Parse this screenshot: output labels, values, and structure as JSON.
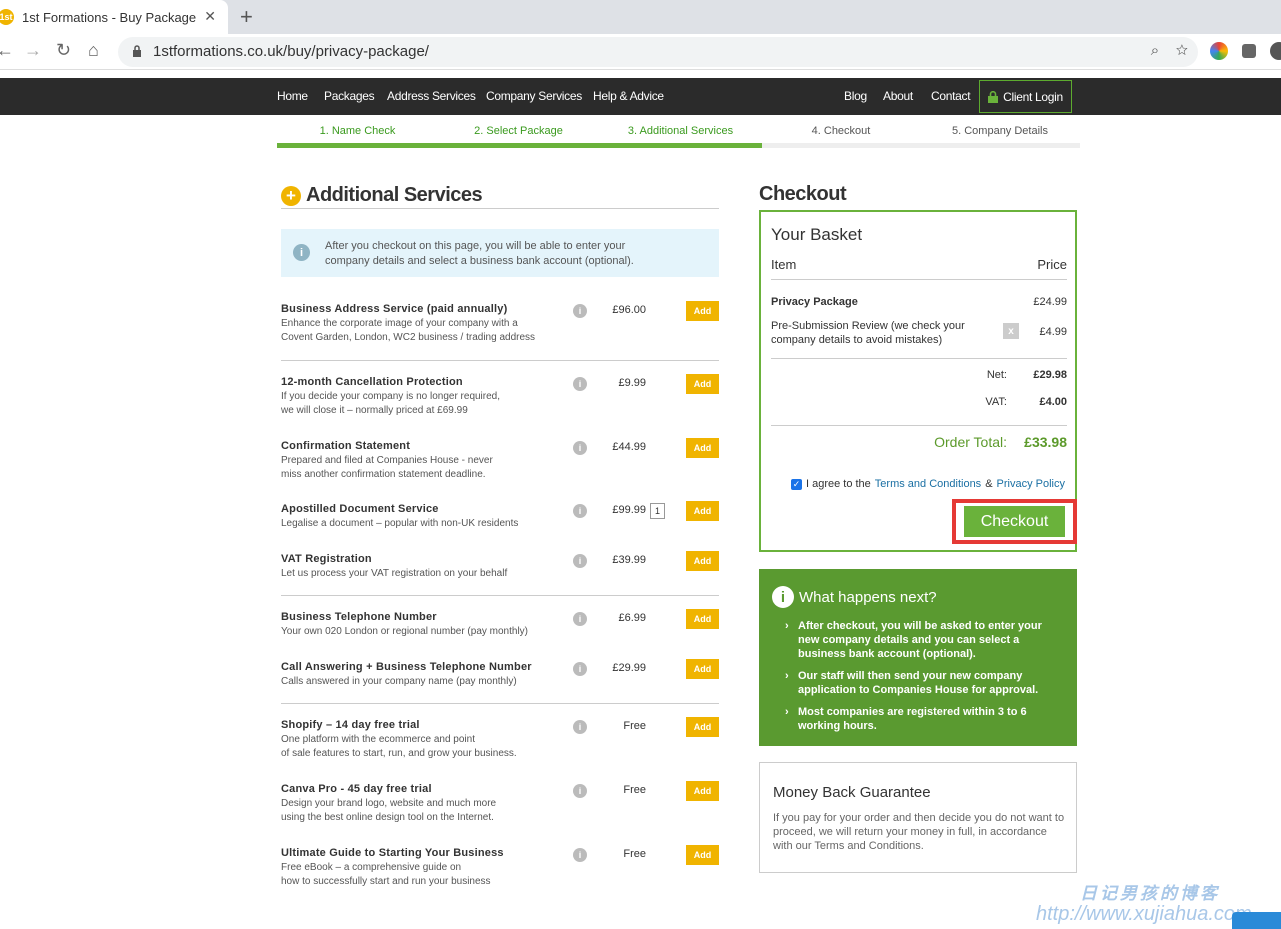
{
  "browser": {
    "tab_title": "1st Formations - Buy Package",
    "url": "1stformations.co.uk/buy/privacy-package/"
  },
  "nav": {
    "left": [
      "Home",
      "Packages",
      "Address Services",
      "Company Services",
      "Help & Advice"
    ],
    "right": [
      "Blog",
      "About",
      "Contact"
    ],
    "login": "Client Login"
  },
  "steps": [
    "1. Name Check",
    "2. Select Package",
    "3. Additional Services",
    "4. Checkout",
    "5. Company Details"
  ],
  "additional": {
    "title": "Additional Services",
    "info": "After you checkout on this page, you will be able to enter your company details and select a business bank account (optional).",
    "add_label": "Add",
    "services": [
      {
        "name": "Business Address Service (paid annually)",
        "desc1": "Enhance the corporate image of your company with a",
        "desc2": "Covent Garden, London, WC2 business / trading address",
        "price": "£96.00"
      },
      {
        "name": "12-month Cancellation Protection",
        "desc1": "If you decide your company is no longer required,",
        "desc2": "we will close it – normally priced at £69.99",
        "price": "£9.99"
      },
      {
        "name": "Confirmation Statement",
        "desc1": "Prepared and filed at Companies House - never",
        "desc2": "miss another confirmation statement deadline.",
        "price": "£44.99"
      },
      {
        "name": "Apostilled Document Service",
        "desc1": "Legalise a document – popular with non-UK residents",
        "desc2": "",
        "price": "£99.99",
        "qty": "1"
      },
      {
        "name": "VAT Registration",
        "desc1": "Let us process your VAT registration on your behalf",
        "desc2": "",
        "price": "£39.99"
      },
      {
        "name": "Business Telephone Number",
        "desc1": "Your own 020 London or regional number (pay monthly)",
        "desc2": "",
        "price": "£6.99"
      },
      {
        "name": "Call Answering + Business Telephone Number",
        "desc1": "Calls answered in your company name (pay monthly)",
        "desc2": "",
        "price": "£29.99"
      },
      {
        "name": "Shopify – 14 day free trial",
        "desc1": "One platform with the ecommerce and point",
        "desc2": "of sale features to start, run, and grow your business.",
        "price": "Free"
      },
      {
        "name": "Canva Pro - 45 day free trial",
        "desc1": "Design your brand logo, website and much more",
        "desc2": "using the best online design tool on the Internet.",
        "price": "Free"
      },
      {
        "name": "Ultimate Guide to Starting Your Business",
        "desc1": "Free eBook – a comprehensive guide on",
        "desc2": "how to successfully start and run your business",
        "price": "Free"
      }
    ]
  },
  "checkout": {
    "title": "Checkout",
    "basket_title": "Your Basket",
    "col_item": "Item",
    "col_price": "Price",
    "items": [
      {
        "name": "Privacy Package",
        "price": "£24.99"
      },
      {
        "name": "Pre-Submission Review (we check your company details to avoid mistakes)",
        "price": "£4.99",
        "remove": "x"
      }
    ],
    "net_label": "Net:",
    "net": "£29.98",
    "vat_label": "VAT:",
    "vat": "£4.00",
    "total_label": "Order Total:",
    "total": "£33.98",
    "agree_text": "I agree to the",
    "terms_link": "Terms and Conditions",
    "amp": "&",
    "privacy_link": "Privacy Policy",
    "button": "Checkout"
  },
  "next": {
    "title": "What happens next?",
    "items": [
      "After checkout, you will be asked to enter your new company details and you can select a business bank account (optional).",
      "Our staff will then send your new company application to Companies House for approval.",
      "Most companies are registered within 3 to 6 working hours."
    ]
  },
  "guarantee": {
    "title": "Money Back Guarantee",
    "text": "If you pay for your order and then decide you do not want to proceed, we will return your money in full, in accordance with our Terms and Conditions."
  },
  "watermark": {
    "line1": "日记男孩的博客",
    "line2": "http://www.xujiahua.com"
  }
}
